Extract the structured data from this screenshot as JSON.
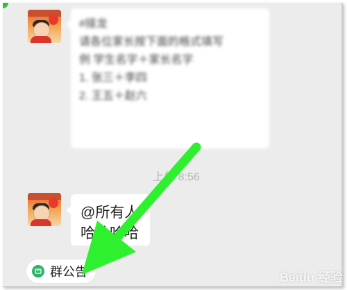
{
  "messages": [
    {
      "blurred_lines": [
        "#接龙",
        "请各位家长按下面的格式填写",
        "例 学生名字＋家长名字",
        "",
        "1. 张三＋李四",
        "2. 王五＋赵六"
      ]
    },
    {
      "text_line1": "@所有人",
      "text_line2": "哈哈哈哈"
    }
  ],
  "timestamp": "上午 8:56",
  "group_notice": {
    "label": "群公告"
  },
  "watermark": "Baidu 经验",
  "colors": {
    "arrow": "#2ef02e",
    "notice_icon": "#2fb36a",
    "chat_bg": "#ececec"
  }
}
